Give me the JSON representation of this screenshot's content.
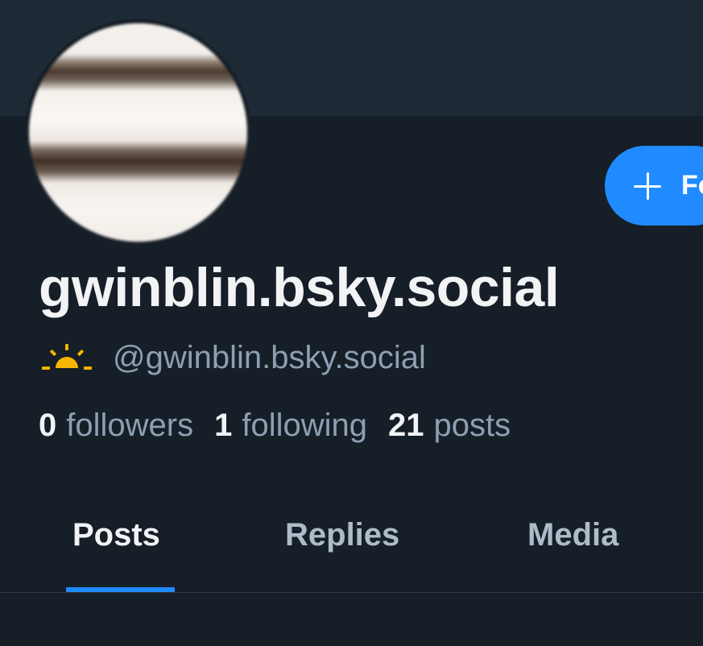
{
  "profile": {
    "display_name": "gwinblin.bsky.social",
    "handle": "@gwinblin.bsky.social",
    "status_icon": "sunrise-icon"
  },
  "actions": {
    "follow_label": "Fo"
  },
  "stats": {
    "followers_count": "0",
    "followers_label": "followers",
    "following_count": "1",
    "following_label": "following",
    "posts_count": "21",
    "posts_label": "posts"
  },
  "tabs": [
    {
      "label": "Posts",
      "active": true
    },
    {
      "label": "Replies",
      "active": false
    },
    {
      "label": "Media",
      "active": false
    }
  ],
  "colors": {
    "background": "#161e27",
    "banner": "#1e2936",
    "accent": "#208bfe",
    "muted_text": "#8d9fb2",
    "sun": "#f5b500"
  }
}
